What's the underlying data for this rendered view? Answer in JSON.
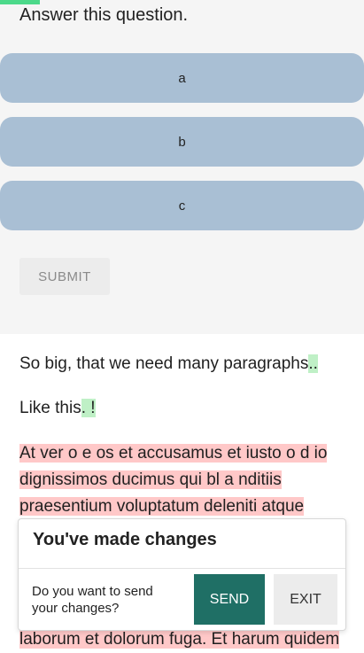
{
  "quiz": {
    "question": "Answer this question.",
    "options": [
      "a",
      "b",
      "c"
    ],
    "submit_label": "SUBMIT"
  },
  "content": {
    "para1_text": "So big, that we need many paragraphs",
    "para1_highlight": "..",
    "para2_text": "Like this",
    "para2_highlight": ". !",
    "para3_lines": [
      "At ver o  e os et accusamus et iusto o d io",
      "dignissimos ducimus qui bl a nditiis",
      "praesentium voluptatum deleniti atque"
    ],
    "para3_tail": "laborum et dolorum fuga. Et harum quidem"
  },
  "modal": {
    "title": "You've made changes",
    "message": "Do you want to send your changes?",
    "send_label": "SEND",
    "exit_label": "EXIT"
  },
  "colors": {
    "accent_green": "#4cd98a",
    "option_bg": "#a9bfd4",
    "send_bg": "#1f6f65",
    "highlight_pink": "#ffc8c8",
    "highlight_green": "#bff0c6"
  }
}
